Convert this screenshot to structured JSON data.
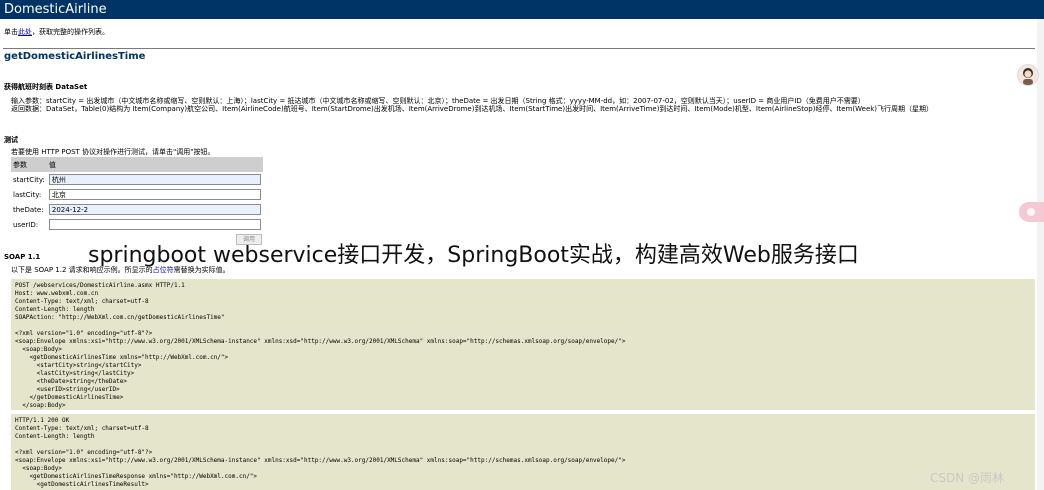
{
  "banner": {
    "title": "DomesticAirline"
  },
  "intro": {
    "prefix": "单击",
    "link": "此处",
    "suffix": "，获取完整的操作列表。"
  },
  "operation": {
    "name": "getDomesticAirlinesTime"
  },
  "description": {
    "title": "获得航班时刻表 DataSet",
    "input_line": "输入参数：startCity = 出发城市（中文城市名称或缩写、空则默认：上海）；lastCity = 抵达城市（中文城市名称或缩写、空则默认：北京）；theDate = 出发日期（String 格式：yyyy-MM-dd，如：2007-07-02，空则默认当天）；userID = 商业用户ID（免费用户不需要）",
    "return_line": "返回数据：DataSet，Table(0)结构为 Item(Company)航空公司、Item(AirlineCode)航班号、Item(StartDrome)出发机场、Item(ArriveDrome)到达机场、Item(StartTime)出发时间、Item(ArriveTime)到达时间、Item(Mode)机型、Item(AirlineStop)经停、Item(Week)飞行周期（星期）"
  },
  "test": {
    "title": "测试",
    "hint": "若要使用 HTTP POST 协议对操作进行测试，请单击\"调用\"按钮。",
    "col_param": "参数",
    "col_value": "值",
    "rows": [
      {
        "label": "startCity:",
        "value": "杭州"
      },
      {
        "label": "lastCity:",
        "value": "北京"
      },
      {
        "label": "theDate:",
        "value": "2024-12-2"
      },
      {
        "label": "userID:",
        "value": ""
      }
    ],
    "invoke_label": "调用"
  },
  "soap": {
    "title": "SOAP 1.1",
    "hint_prefix": "以下是 SOAP 1.2 请求和响应示例。所显示的",
    "hint_link": "占位符",
    "hint_suffix": "需替换为实际值。",
    "request": "POST /webservices/DomesticAirline.asmx HTTP/1.1\nHost: www.webxml.com.cn\nContent-Type: text/xml; charset=utf-8\nContent-Length: length\nSOAPAction: \"http://WebXml.com.cn/getDomesticAirlinesTime\"\n\n<?xml version=\"1.0\" encoding=\"utf-8\"?>\n<soap:Envelope xmlns:xsi=\"http://www.w3.org/2001/XMLSchema-instance\" xmlns:xsd=\"http://www.w3.org/2001/XMLSchema\" xmlns:soap=\"http://schemas.xmlsoap.org/soap/envelope/\">\n  <soap:Body>\n    <getDomesticAirlinesTime xmlns=\"http://WebXml.com.cn/\">\n      <startCity>string</startCity>\n      <lastCity>string</lastCity>\n      <theDate>string</theDate>\n      <userID>string</userID>\n    </getDomesticAirlinesTime>\n  </soap:Body>\n</soap:Envelope>",
    "response": "HTTP/1.1 200 OK\nContent-Type: text/xml; charset=utf-8\nContent-Length: length\n\n<?xml version=\"1.0\" encoding=\"utf-8\"?>\n<soap:Envelope xmlns:xsi=\"http://www.w3.org/2001/XMLSchema-instance\" xmlns:xsd=\"http://www.w3.org/2001/XMLSchema\" xmlns:soap=\"http://schemas.xmlsoap.org/soap/envelope/\">\n  <soap:Body>\n    <getDomesticAirlinesTimeResponse xmlns=\"http://WebXml.com.cn/\">\n      <getDomesticAirlinesTimeResult>"
  },
  "overlay": {
    "caption": "springboot webservice接口开发，SpringBoot实战，构建高效Web服务接口"
  },
  "watermark": {
    "text": "CSDN @雨林"
  },
  "colors": {
    "banner": "#003366",
    "code_bg": "#e5e5cc",
    "header_row": "#cecece"
  }
}
